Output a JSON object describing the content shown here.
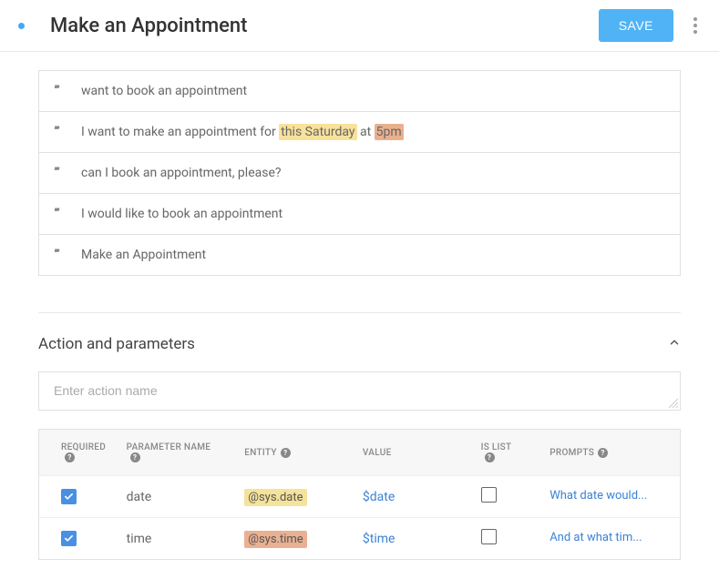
{
  "header": {
    "title": "Make an Appointment",
    "save_label": "SAVE"
  },
  "phrases": [
    {
      "segments": [
        {
          "text": "want to book an appointment"
        }
      ]
    },
    {
      "segments": [
        {
          "text": "I want to make an appointment for "
        },
        {
          "text": "this Saturday",
          "highlight": "yellow"
        },
        {
          "text": " at "
        },
        {
          "text": "5pm",
          "highlight": "orange"
        }
      ]
    },
    {
      "segments": [
        {
          "text": "can I book an appointment, please?"
        }
      ]
    },
    {
      "segments": [
        {
          "text": "I would like to book an appointment"
        }
      ]
    },
    {
      "segments": [
        {
          "text": "Make an Appointment"
        }
      ]
    }
  ],
  "section": {
    "title": "Action and parameters",
    "action_placeholder": "Enter action name"
  },
  "params_headers": {
    "required": "REQUIRED",
    "parameter_name": "PARAMETER NAME",
    "entity": "ENTITY",
    "value": "VALUE",
    "is_list": "IS LIST",
    "prompts": "PROMPTS"
  },
  "params": [
    {
      "required": true,
      "name": "date",
      "entity": "@sys.date",
      "entity_color": "yellow",
      "value": "$date",
      "is_list": false,
      "prompt": "What date would..."
    },
    {
      "required": true,
      "name": "time",
      "entity": "@sys.time",
      "entity_color": "orange",
      "value": "$time",
      "is_list": false,
      "prompt": "And at what tim..."
    }
  ]
}
